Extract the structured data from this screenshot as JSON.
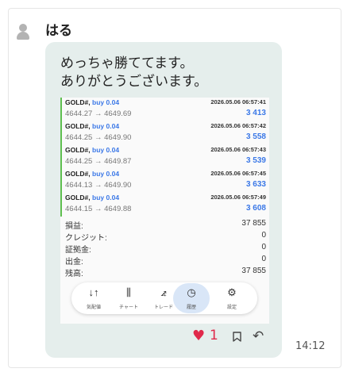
{
  "post": {
    "username": "はる",
    "message": "めっちゃ勝ててます。\nありがとうございます。",
    "timestamp": "14:12",
    "like_count": "1"
  },
  "screenshot": {
    "trades": [
      {
        "symbol": "GOLD#,",
        "side": "buy 0.04",
        "time": "2026.05.06 06:57:41",
        "prices": "4644.27 → 4649.69",
        "profit": "3 413"
      },
      {
        "symbol": "GOLD#,",
        "side": "buy 0.04",
        "time": "2026.05.06 06:57:42",
        "prices": "4644.25 → 4649.90",
        "profit": "3 558"
      },
      {
        "symbol": "GOLD#,",
        "side": "buy 0.04",
        "time": "2026.05.06 06:57:43",
        "prices": "4644.25 → 4649.87",
        "profit": "3 539"
      },
      {
        "symbol": "GOLD#,",
        "side": "buy 0.04",
        "time": "2026.05.06 06:57:45",
        "prices": "4644.13 → 4649.90",
        "profit": "3 633"
      },
      {
        "symbol": "GOLD#,",
        "side": "buy 0.04",
        "time": "2026.05.06 06:57:49",
        "prices": "4644.15 → 4649.88",
        "profit": "3 608"
      }
    ],
    "summary": [
      {
        "label": "損益:",
        "value": "37 855"
      },
      {
        "label": "クレジット:",
        "value": "0"
      },
      {
        "label": "証拠金:",
        "value": "0"
      },
      {
        "label": "出金:",
        "value": "0"
      },
      {
        "label": "残高:",
        "value": "37 855"
      }
    ],
    "nav": [
      {
        "label": "気配値",
        "icon": "↓↑"
      },
      {
        "label": "チャート",
        "icon": "⫼"
      },
      {
        "label": "トレード",
        "icon": "⦨"
      },
      {
        "label": "履歴",
        "icon": "◷"
      },
      {
        "label": "設定",
        "icon": "⚙"
      }
    ],
    "nav_selected": "履歴"
  },
  "icons": {
    "heart": "♥",
    "reply": "↶"
  },
  "colors": {
    "bubble": "#e5eeec",
    "accent_blue": "#3b78e7",
    "heart": "#e0294a",
    "trade_bar": "#5fbf50"
  }
}
